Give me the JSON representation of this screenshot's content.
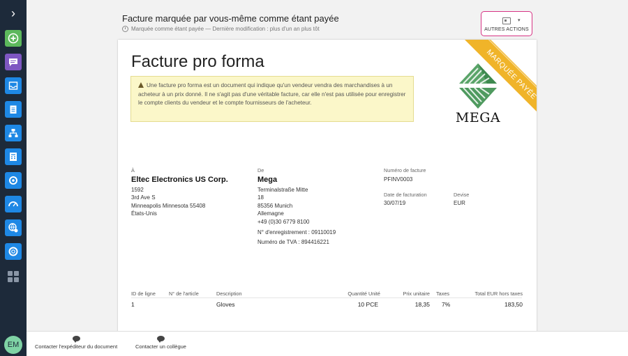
{
  "sidebar": {
    "toggle": "›",
    "avatar": "EM",
    "items": [
      {
        "name": "create-icon",
        "color": "#5cb85c"
      },
      {
        "name": "messages-icon",
        "color": "#7e57c2"
      },
      {
        "name": "inbox-icon",
        "color": "#1e88e5"
      },
      {
        "name": "clipboard-icon",
        "color": "#1e88e5"
      },
      {
        "name": "org-chart-icon",
        "color": "#1e88e5"
      },
      {
        "name": "calculator-icon",
        "color": "#1e88e5"
      },
      {
        "name": "settings-icon",
        "color": "#1e88e5"
      },
      {
        "name": "dashboard-icon",
        "color": "#1e88e5"
      },
      {
        "name": "globe-settings-icon",
        "color": "#1e88e5"
      },
      {
        "name": "support-icon",
        "color": "#1e88e5"
      },
      {
        "name": "apps-grid-icon",
        "color": "#6b7787"
      }
    ]
  },
  "header": {
    "title": "Facture marquée par vous-même comme étant payée",
    "subtitle": "Marquée comme étant payée — Dernière modification : plus d'un an plus tôt",
    "actions_label": "AUTRES ACTIONS",
    "actions_caret": "▾"
  },
  "document": {
    "title": "Facture pro forma",
    "notice": "Une facture pro forma est un document qui indique qu'un vendeur vendra des marchandises à un acheteur à un prix donné. Il ne s'agit pas d'une véritable facture, car elle n'est pas utilisée pour enregistrer le compte clients du vendeur et le compte fournisseurs de l'acheteur.",
    "ribbon": "MARQUÉE PAYÉE",
    "logo_text": "MEGA",
    "to": {
      "label": "À",
      "name": "Eltec Electronics US Corp.",
      "line1": "1592",
      "line2": "3rd Ave S",
      "line3": "Minneapolis  Minnesota  55408",
      "line4": "États-Unis"
    },
    "from": {
      "label": "De",
      "name": "Mega",
      "line1": "Terminalstraße Mitte",
      "line2": "18",
      "line3": "85356  Munich",
      "line4": "Allemagne",
      "phone": "+49 (0)30 6779 8100",
      "registration": "N° d'enregistrement : 09110019",
      "vat": "Numéro de TVA : 894416221"
    },
    "invoice_number_label": "Numéro de facture",
    "invoice_number": "PFINV0003",
    "invoice_date_label": "Date de facturation",
    "invoice_date": "30/07/19",
    "currency_label": "Devise",
    "currency": "EUR",
    "table": {
      "headers": {
        "line_id": "ID de ligne",
        "article": "N° de l'article",
        "description": "Description",
        "qty": "Quantité Unité",
        "unit_price": "Prix unitaire",
        "taxes": "Taxes",
        "total": "Total EUR hors taxes"
      },
      "rows": [
        {
          "line_id": "1",
          "article": "",
          "description": "Gloves",
          "qty": "10 PCE",
          "unit_price": "18,35",
          "taxes": "7%",
          "total": "183,50"
        }
      ]
    }
  },
  "footer": {
    "contact_sender": "Contacter l'expéditeur du document",
    "contact_colleague": "Contacter un collègue"
  }
}
